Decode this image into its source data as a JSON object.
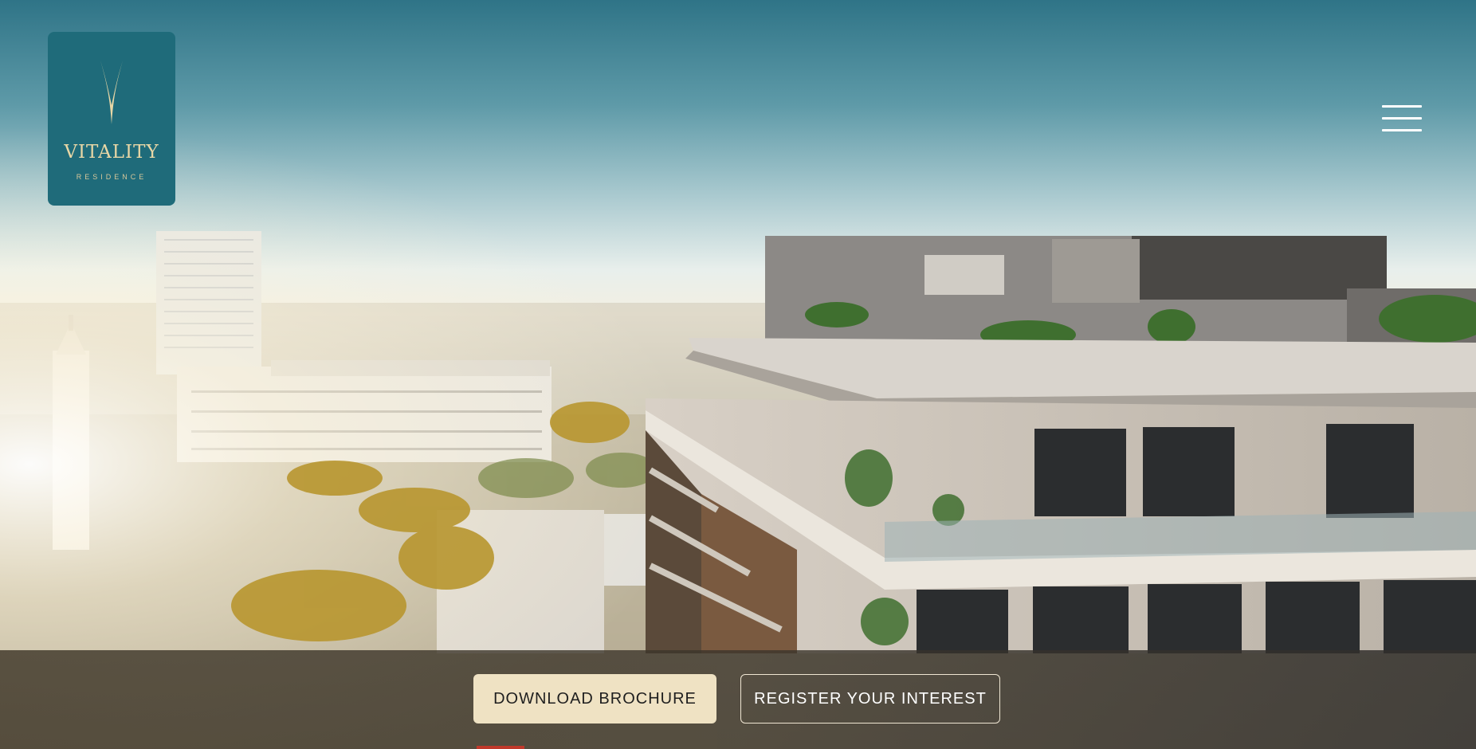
{
  "logo": {
    "brand": "VITALITY",
    "sub": "RESIDENCE",
    "background_color": "#1f6b7a",
    "text_color": "#e8d7a6"
  },
  "menu": {
    "icon": "hamburger-menu-icon"
  },
  "cta": {
    "primary_label": "DOWNLOAD BROCHURE",
    "secondary_label": "REGISTER YOUR INTEREST",
    "primary_color": "#efe2c3"
  },
  "slider": {
    "accent_color": "#c0392b"
  }
}
